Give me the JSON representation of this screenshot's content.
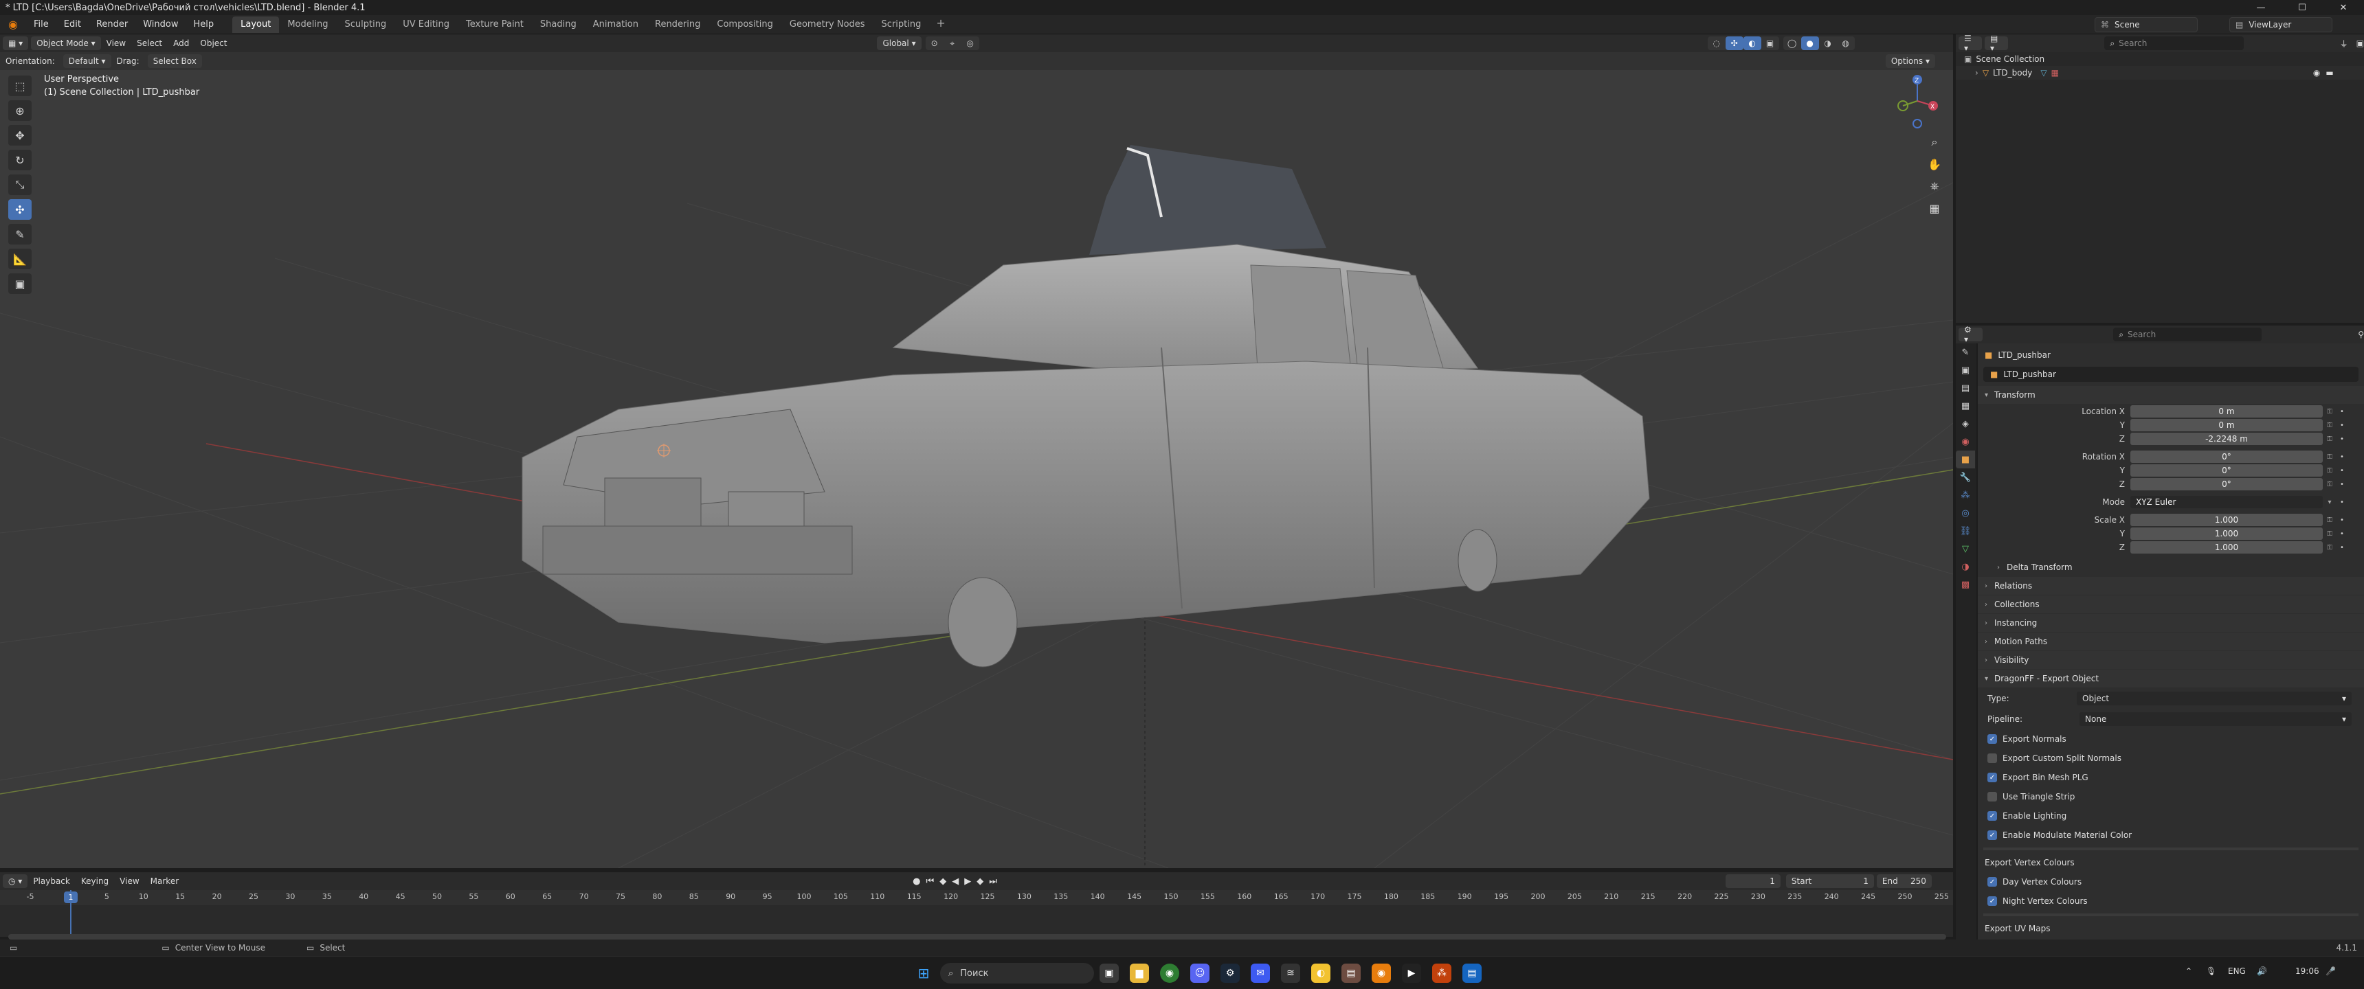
{
  "window": {
    "title": "* LTD [C:\\Users\\Bagda\\OneDrive\\Рабочий стол\\vehicles\\LTD.blend] - Blender 4.1",
    "controls": [
      "—",
      "☐",
      "✕"
    ]
  },
  "menu": [
    "File",
    "Edit",
    "Render",
    "Window",
    "Help"
  ],
  "workspaces": [
    "Layout",
    "Modeling",
    "Sculpting",
    "UV Editing",
    "Texture Paint",
    "Shading",
    "Animation",
    "Rendering",
    "Compositing",
    "Geometry Nodes",
    "Scripting"
  ],
  "active_workspace": "Layout",
  "scene": {
    "label": "Scene",
    "view_layer": "ViewLayer"
  },
  "viewport": {
    "mode": "Object Mode",
    "menus": [
      "View",
      "Select",
      "Add",
      "Object"
    ],
    "transform_orientation": "Global",
    "orientation_label": "Orientation:",
    "orientation_value": "Default",
    "drag_label": "Drag:",
    "drag_value": "Select Box",
    "options": "Options",
    "perspective": "User Perspective",
    "collection_info": "(1) Scene Collection | LTD_pushbar"
  },
  "gizmo": {
    "y": "Y",
    "x": "X",
    "z": "Z"
  },
  "timeline": {
    "menus": [
      "Playback",
      "Keying",
      "View",
      "Marker"
    ],
    "current_frame": "1",
    "start_label": "Start",
    "start": "1",
    "end_label": "End",
    "end": "250",
    "ticks": [
      "-5",
      "1",
      "5",
      "10",
      "15",
      "20",
      "25",
      "30",
      "35",
      "40",
      "45",
      "50",
      "55",
      "60",
      "65",
      "70",
      "75",
      "80",
      "85",
      "90",
      "95",
      "100",
      "105",
      "110",
      "115",
      "120",
      "125",
      "130",
      "135",
      "140",
      "145",
      "150",
      "155",
      "160",
      "165",
      "170",
      "175",
      "180",
      "185",
      "190",
      "195",
      "200",
      "205",
      "210",
      "215",
      "220",
      "225",
      "230",
      "235",
      "240",
      "245",
      "250",
      "255"
    ]
  },
  "status": {
    "hint1": "Center View to Mouse",
    "hint2": "Select",
    "version": "4.1.1"
  },
  "outliner": {
    "search_placeholder": "Search",
    "root": "Scene Collection",
    "items": [
      {
        "name": "LTD_body"
      }
    ]
  },
  "properties": {
    "search_placeholder": "Search",
    "object": "LTD_pushbar",
    "object_name_field": "LTD_pushbar",
    "transform": {
      "header": "Transform",
      "location_label": "Location X",
      "location": [
        "0 m",
        "0 m",
        "-2.2248 m"
      ],
      "rotation_label": "Rotation X",
      "rotation": [
        "0°",
        "0°",
        "0°"
      ],
      "mode_label": "Mode",
      "mode": "XYZ Euler",
      "scale_label": "Scale X",
      "scale": [
        "1.000",
        "1.000",
        "1.000"
      ],
      "y": "Y",
      "z": "Z"
    },
    "collapsed_panels": [
      "Delta Transform",
      "Relations",
      "Collections",
      "Instancing",
      "Motion Paths",
      "Visibility"
    ],
    "dragonff": {
      "header": "DragonFF - Export Object",
      "type_label": "Type:",
      "type": "Object",
      "pipeline_label": "Pipeline:",
      "pipeline": "None",
      "checks": [
        {
          "label": "Export Normals",
          "on": true
        },
        {
          "label": "Export Custom Split Normals",
          "on": false
        },
        {
          "label": "Export Bin Mesh PLG",
          "on": true
        },
        {
          "label": "Use Triangle Strip",
          "on": false
        },
        {
          "label": "Enable Lighting",
          "on": true
        },
        {
          "label": "Enable Modulate Material Color",
          "on": true
        }
      ],
      "vertex_colours_header": "Export Vertex Colours",
      "vertex_checks": [
        {
          "label": "Day Vertex Colours",
          "on": true
        },
        {
          "label": "Night Vertex Colours",
          "on": true
        }
      ],
      "uv_header": "Export UV Maps"
    }
  },
  "taskbar": {
    "search_placeholder": "Поиск",
    "lang": "ENG",
    "time": "19:06"
  },
  "colors": {
    "accent": "#4772b3",
    "brand": "#e87d0d"
  }
}
